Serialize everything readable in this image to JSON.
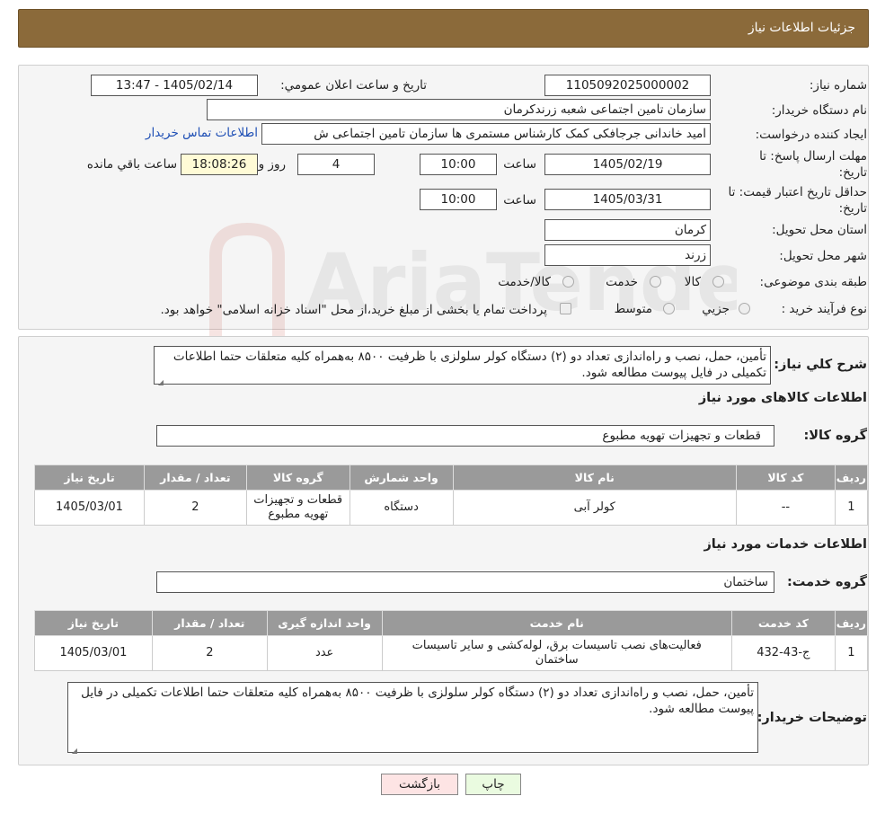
{
  "header": {
    "title": "جزئیات اطلاعات نیاز"
  },
  "form": {
    "need_number_label": "شماره نیاز:",
    "need_number": "1105092025000002",
    "announce_label": "تاریخ و ساعت اعلان عمومي:",
    "announce_value": "1405/02/14 - 13:47",
    "buyer_org_label": "نام دستگاه خریدار:",
    "buyer_org": "سازمان تامین اجتماعی شعبه زرندکرمان",
    "requester_label": "ایجاد کننده درخواست:",
    "requester": "امید خاندانی جرجافکی کمک کارشناس مستمری ها  سازمان تامین اجتماعی ش",
    "contact_link": "اطلاعات تماس خریدار",
    "deadline_label_1": "مهلت ارسال پاسخ: تا",
    "deadline_label_2": "تاریخ:",
    "deadline_date": "1405/02/19",
    "hour_label": "ساعت",
    "deadline_hour": "10:00",
    "days": "4",
    "day_and_label": "روز و",
    "remaining_time": "18:08:26",
    "remaining_label": "ساعت باقي مانده",
    "validity_label_1": "حداقل تاریخ اعتبار قیمت: تا",
    "validity_label_2": "تاریخ:",
    "validity_date": "1405/03/31",
    "validity_hour": "10:00",
    "province_label": "استان محل تحویل:",
    "province": "کرمان",
    "city_label": "شهر محل تحویل:",
    "city": "زرند",
    "category_label": "طبقه بندی موضوعی:",
    "category_options": [
      "کالا",
      "خدمت",
      "کالا/خدمت"
    ],
    "purchase_type_label": "نوع فرآیند خرید :",
    "purchase_options": [
      "جزيي",
      "متوسط"
    ],
    "purchase_note": "پرداخت تمام یا بخشی از مبلغ خرید،از محل \"اسناد خزانه اسلامی\" خواهد بود."
  },
  "summary": {
    "label": "شرح کلي نیاز:",
    "text": "تأمین، حمل، نصب و راه‌اندازی تعداد دو (۲) دستگاه کولر سلولزی با ظرفیت ۸۵۰۰ به‌همراه کلیه متعلقات حتما اطلاعات تکمیلی در فایل پیوست مطالعه شود."
  },
  "goods": {
    "section_title": "اطلاعات کالاهای مورد نیاز",
    "group_label": "گروه کالا:",
    "group_value": "قطعات و تجهیزات تهویه مطبوع",
    "columns": [
      "ردیف",
      "کد کالا",
      "نام کالا",
      "واحد شمارش",
      "گروه کالا",
      "تعداد / مقدار",
      "تاریخ نیاز"
    ],
    "rows": [
      [
        "1",
        "--",
        "کولر آبی",
        "دستگاه",
        "قطعات و تجهیزات تهویه مطبوع",
        "2",
        "1405/03/01"
      ]
    ]
  },
  "services": {
    "section_title": "اطلاعات خدمات مورد نیاز",
    "group_label": "گروه خدمت:",
    "group_value": "ساختمان",
    "columns": [
      "ردیف",
      "کد خدمت",
      "نام خدمت",
      "واحد اندازه گیری",
      "تعداد / مقدار",
      "تاریخ نیاز"
    ],
    "rows": [
      [
        "1",
        "ج-43-432",
        "فعالیت‌های نصب تاسیسات برق، لوله‌کشی و سایر تاسیسات ساختمان",
        "عدد",
        "2",
        "1405/03/01"
      ]
    ]
  },
  "buyer_notes": {
    "label": "توضیحات خریدار:",
    "text": "تأمین، حمل، نصب و راه‌اندازی تعداد دو (۲) دستگاه کولر سلولزی با ظرفیت ۸۵۰۰ به‌همراه کلیه متعلقات حتما اطلاعات تکمیلی در فایل پیوست مطالعه شود."
  },
  "buttons": {
    "print": "چاپ",
    "back": "بازگشت"
  },
  "colors": {
    "header": "#8b6a3a",
    "table_header": "#9a9a9a",
    "link": "#1f4fb5",
    "print_btn": "#eafbe0",
    "back_btn": "#fde4e4"
  },
  "watermark": "AriaTender.neT"
}
